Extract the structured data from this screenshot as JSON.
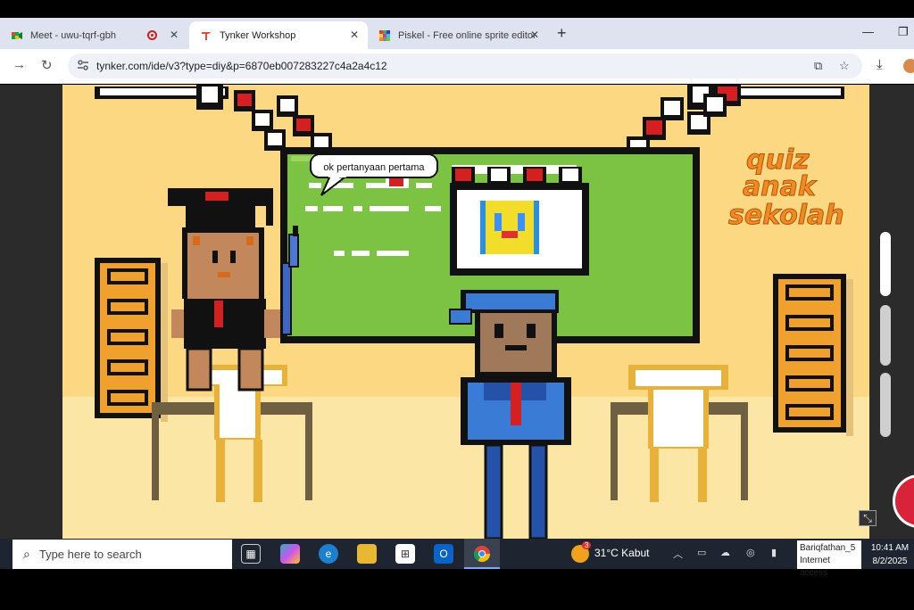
{
  "browser": {
    "tabs": [
      {
        "title": "Meet - uwu-tqrf-gbh",
        "favicon": "google-meet-icon",
        "recording": true
      },
      {
        "title": "Tynker Workshop",
        "favicon": "tynker-icon",
        "active": true
      },
      {
        "title": "Piskel - Free online sprite editor",
        "favicon": "piskel-icon"
      }
    ],
    "new_tab_label": "+",
    "url": "tynker.com/ide/v3?type=diy&p=6870eb007283227c4a2a4c12"
  },
  "game": {
    "speech": "ok pertanyaan pertama",
    "title_lines": [
      "quiz",
      "anak",
      "sekolah"
    ]
  },
  "taskbar": {
    "search_placeholder": "Type here to search",
    "weather_text": "31°C  Kabut",
    "weather_badge": "3",
    "network_name": "Bariqfathan_5",
    "network_status": "Internet access",
    "time": "10:41 AM",
    "date": "8/2/2025"
  },
  "colors": {
    "tab_strip": "#dfe3ef",
    "accent_record": "#c5221f",
    "taskbar": "#1e2430",
    "board_green": "#7cc243",
    "wall_yellow": "#fcd882",
    "title_orange": "#f18a1f"
  }
}
